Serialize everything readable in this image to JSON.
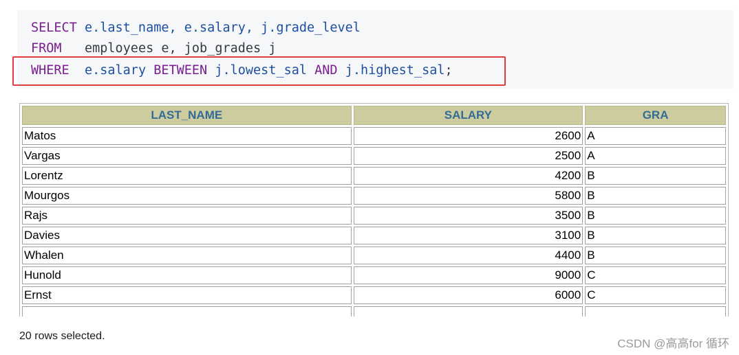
{
  "code": {
    "line1": {
      "kw1": "SELECT",
      "body": " e.last_name, e.salary, j.grade_level"
    },
    "line2": {
      "kw1": "FROM",
      "body": "   employees e, job_grades j"
    },
    "line3": {
      "kw1": "WHERE",
      "sp": "  ",
      "col": "e.salary",
      "kw2": " BETWEEN ",
      "ref1": "j.lowest_sal",
      "kw3": " AND ",
      "ref2": "j.highest_sal",
      "end": ";"
    }
  },
  "table": {
    "headers": [
      "LAST_NAME",
      "SALARY",
      "GRA"
    ],
    "rows": [
      [
        "Matos",
        "2600",
        "A"
      ],
      [
        "Vargas",
        "2500",
        "A"
      ],
      [
        "Lorentz",
        "4200",
        "B"
      ],
      [
        "Mourgos",
        "5800",
        "B"
      ],
      [
        "Rajs",
        "3500",
        "B"
      ],
      [
        "Davies",
        "3100",
        "B"
      ],
      [
        "Whalen",
        "4400",
        "B"
      ],
      [
        "Hunold",
        "9000",
        "C"
      ],
      [
        "Ernst",
        "6000",
        "C"
      ]
    ]
  },
  "footer": "20 rows selected.",
  "watermark": "CSDN @高高for 循环",
  "colors": {
    "highlight": "#e23b3b",
    "header_bg": "#cdcc9e",
    "header_text": "#336a96"
  }
}
